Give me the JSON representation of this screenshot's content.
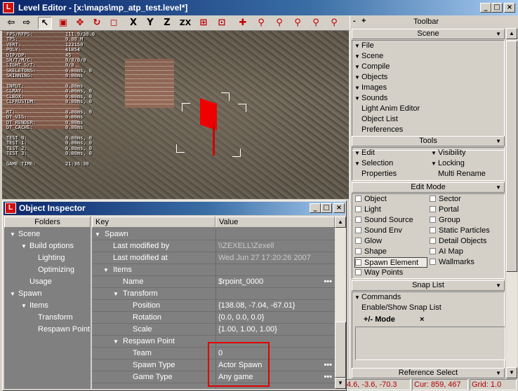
{
  "window": {
    "title": "Level Editor - [x:\\maps\\mp_atp_test.level*]",
    "icon_letter": "L",
    "minimize": "_",
    "maximize": "□",
    "close": "×"
  },
  "toolbar": {
    "buttons": [
      {
        "icon": "arrow-left-icon",
        "glyph": "⇦"
      },
      {
        "icon": "arrow-right-icon",
        "glyph": "⇨"
      },
      {
        "icon": "select-arrow-icon",
        "glyph": "↖"
      },
      {
        "icon": "cube-icon",
        "glyph": "▣"
      },
      {
        "icon": "move-icon",
        "glyph": "✥"
      },
      {
        "icon": "rotate-icon",
        "glyph": "↻"
      },
      {
        "icon": "scale-icon",
        "glyph": "◻"
      },
      {
        "icon": "axis-x-icon",
        "glyph": "X"
      },
      {
        "icon": "axis-y-icon",
        "glyph": "Y"
      },
      {
        "icon": "axis-z-icon",
        "glyph": "Z"
      },
      {
        "icon": "axis-zx-icon",
        "glyph": "ZX"
      },
      {
        "icon": "snap-grid-icon",
        "glyph": "⊞"
      },
      {
        "icon": "snap-object-icon",
        "glyph": "⊡"
      },
      {
        "icon": "snap-point-icon",
        "glyph": "✚"
      },
      {
        "icon": "magnet-icon",
        "glyph": "⚲"
      },
      {
        "icon": "magnet-move-icon",
        "glyph": "⚲"
      },
      {
        "icon": "magnet-rotate-icon",
        "glyph": "⚲"
      },
      {
        "icon": "magnet-scale-icon",
        "glyph": "⚲"
      },
      {
        "icon": "magnet-extra-icon",
        "glyph": "⚲"
      }
    ]
  },
  "viewport": {
    "stats": [
      {
        "k": "FPS/RFPS:",
        "v": "111.9/30.0"
      },
      {
        "k": "TPS:",
        "v": "0.00 M"
      },
      {
        "k": "VERT:",
        "v": "123150"
      },
      {
        "k": "POLY:",
        "v": "41054"
      },
      {
        "k": "DIP/DP:",
        "v": "45"
      },
      {
        "k": "SH/T/M/C:",
        "v": "0/0/0/0"
      },
      {
        "k": "LIGHT S/T:",
        "v": "0/0"
      },
      {
        "k": "SKELETONS:",
        "v": "0.00ms, 0"
      },
      {
        "k": "SKINNING:",
        "v": "0.00ms"
      },
      {
        "k": "",
        "v": ""
      },
      {
        "k": "INPUT:",
        "v": "0.00ms"
      },
      {
        "k": "CLRAY:",
        "v": "0.00ms, 0"
      },
      {
        "k": "CLBOX:",
        "v": "0.00ms, 0"
      },
      {
        "k": "CLFRUSTUM:",
        "v": "0.00ms, 0"
      },
      {
        "k": "",
        "v": ""
      },
      {
        "k": "RT:",
        "v": "0.00ms, 0"
      },
      {
        "k": "DT_VIS:",
        "v": "0.00ms"
      },
      {
        "k": "DT_RENDER:",
        "v": "0.00ms"
      },
      {
        "k": "DT_CACHE:",
        "v": "0.00ms"
      },
      {
        "k": "",
        "v": ""
      },
      {
        "k": "TEST 0:",
        "v": "0.00ms, 0"
      },
      {
        "k": "TEST 1:",
        "v": "0.00ms, 0"
      },
      {
        "k": "TEST 2:",
        "v": "0.00ms, 0"
      },
      {
        "k": "TEST 3:",
        "v": "0.00ms, 0"
      },
      {
        "k": "",
        "v": ""
      },
      {
        "k": "GAME TIME:",
        "v": "21:36:30"
      }
    ]
  },
  "rpanel": {
    "toolbar_title": "Toolbar",
    "minus": "-",
    "plus": "+",
    "scene": {
      "title": "Scene",
      "items": [
        "File",
        "Scene",
        "Compile",
        "Objects",
        "Images",
        "Sounds"
      ],
      "plain_items": [
        "Light Anim Editor",
        "Object List",
        "Preferences"
      ]
    },
    "tools": {
      "title": "Tools",
      "left": [
        "Edit",
        "Selection",
        "Properties"
      ],
      "right": [
        "Visibility",
        "Locking",
        "Multi Rename"
      ]
    },
    "edit_mode": {
      "title": "Edit Mode",
      "left": [
        "Object",
        "Light",
        "Sound Source",
        "Sound Env",
        "Glow",
        "Shape",
        "Spawn Element",
        "Way Points"
      ],
      "right": [
        "Sector",
        "Portal",
        "Group",
        "Static Particles",
        "Detail Objects",
        "AI Map",
        "Wallmarks"
      ],
      "selected": "Spawn Element"
    },
    "snap_list": {
      "title": "Snap List",
      "commands": "Commands",
      "enable_show": "Enable/Show Snap List",
      "mode_label": "+/- Mode",
      "clear": "×"
    },
    "reference_select": "Reference Select"
  },
  "status": {
    "coords": "4.6, -3.6, -70.3",
    "cursor": "Cur: 859, 467",
    "grid": "Grid: 1.0"
  },
  "inspector": {
    "title": "Object Inspector",
    "folders_header": "Folders",
    "key_header": "Key",
    "value_header": "Value",
    "folders": [
      {
        "label": "Scene",
        "depth": 0,
        "expanded": true
      },
      {
        "label": "Build options",
        "depth": 1,
        "expanded": true
      },
      {
        "label": "Lighting",
        "depth": 2,
        "expanded": false
      },
      {
        "label": "Optimizing",
        "depth": 2,
        "expanded": false
      },
      {
        "label": "Usage",
        "depth": 1,
        "expanded": false
      },
      {
        "label": "Spawn",
        "depth": 0,
        "expanded": true
      },
      {
        "label": "Items",
        "depth": 1,
        "expanded": true
      },
      {
        "label": "Transform",
        "depth": 2,
        "expanded": false
      },
      {
        "label": "Respawn Point",
        "depth": 2,
        "expanded": false
      }
    ],
    "rows": [
      {
        "key": "Spawn",
        "value": "",
        "depth": 0,
        "group": true,
        "dim": false,
        "dots": false
      },
      {
        "key": "Last modified by",
        "value": "\\\\ZEXELL\\Zexell",
        "depth": 1,
        "group": false,
        "dim": true,
        "dots": false
      },
      {
        "key": "Last modified at",
        "value": "Wed Jun 27 17:20:26 2007",
        "depth": 1,
        "group": false,
        "dim": true,
        "dots": false
      },
      {
        "key": "Items",
        "value": "",
        "depth": 1,
        "group": true,
        "dim": false,
        "dots": false
      },
      {
        "key": "Name",
        "value": "$rpoint_0000",
        "depth": 2,
        "group": false,
        "dim": false,
        "dots": true
      },
      {
        "key": "Transform",
        "value": "",
        "depth": 2,
        "group": true,
        "dim": false,
        "dots": false
      },
      {
        "key": "Position",
        "value": "{138.08, -7.04, -67.01}",
        "depth": 3,
        "group": false,
        "dim": false,
        "dots": false
      },
      {
        "key": "Rotation",
        "value": "{0.0, 0.0, 0.0}",
        "depth": 3,
        "group": false,
        "dim": false,
        "dots": false
      },
      {
        "key": "Scale",
        "value": "{1.00, 1.00, 1.00}",
        "depth": 3,
        "group": false,
        "dim": false,
        "dots": false
      },
      {
        "key": "Respawn Point",
        "value": "",
        "depth": 2,
        "group": true,
        "dim": false,
        "dots": false
      },
      {
        "key": "Team",
        "value": "0",
        "depth": 3,
        "group": false,
        "dim": false,
        "dots": false
      },
      {
        "key": "Spawn Type",
        "value": "Actor Spawn",
        "depth": 3,
        "group": false,
        "dim": false,
        "dots": true
      },
      {
        "key": "Game Type",
        "value": "Any game",
        "depth": 3,
        "group": false,
        "dim": false,
        "dots": true
      }
    ]
  }
}
